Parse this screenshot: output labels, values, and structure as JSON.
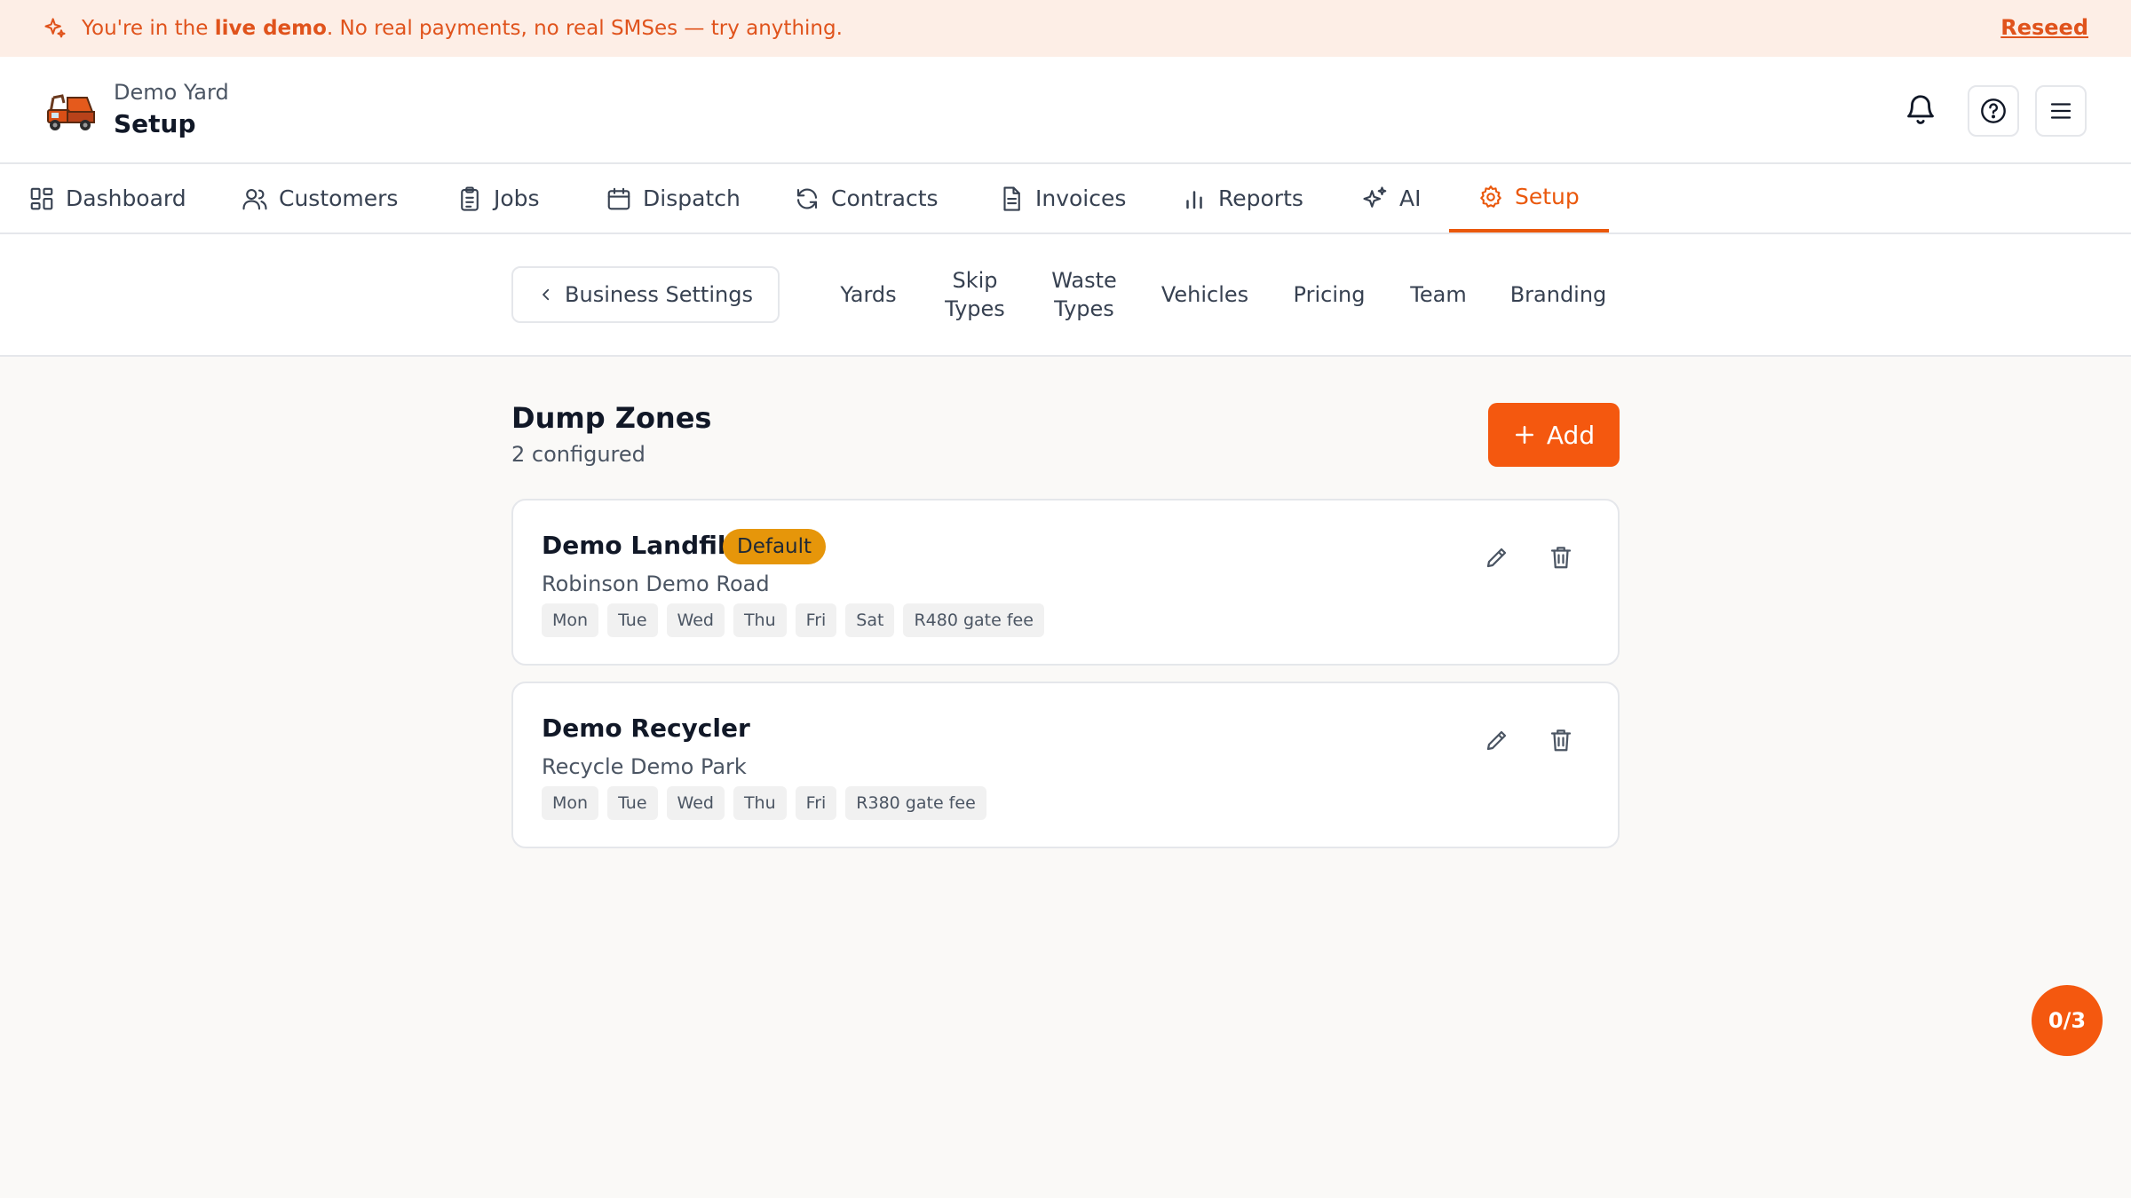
{
  "banner": {
    "text_before": "You're in the ",
    "text_bold": "live demo",
    "text_after": ". No real payments, no real SMSes — try anything.",
    "reseed_label": "Reseed"
  },
  "header": {
    "yard_name": "Demo Yard",
    "page_title": "Setup"
  },
  "nav": {
    "tabs": [
      {
        "label": "Dashboard",
        "icon": "dashboard-icon"
      },
      {
        "label": "Customers",
        "icon": "users-icon"
      },
      {
        "label": "Jobs",
        "icon": "clipboard-icon"
      },
      {
        "label": "Dispatch",
        "icon": "calendar-icon"
      },
      {
        "label": "Contracts",
        "icon": "refresh-icon"
      },
      {
        "label": "Invoices",
        "icon": "document-icon"
      },
      {
        "label": "Reports",
        "icon": "bar-chart-icon"
      },
      {
        "label": "AI",
        "icon": "sparkles-icon"
      },
      {
        "label": "Setup",
        "icon": "gear-icon",
        "active": true
      }
    ]
  },
  "subnav": {
    "back_label": "Business Settings",
    "tabs": [
      {
        "line1": "Yards",
        "line2": ""
      },
      {
        "line1": "Skip",
        "line2": "Types"
      },
      {
        "line1": "Waste",
        "line2": "Types"
      },
      {
        "line1": "Vehicles",
        "line2": ""
      },
      {
        "line1": "Pricing",
        "line2": ""
      },
      {
        "line1": "Team",
        "line2": ""
      },
      {
        "line1": "Branding",
        "line2": ""
      }
    ]
  },
  "section": {
    "title": "Dump Zones",
    "subtitle": "2 configured",
    "add_label": "Add"
  },
  "zones": [
    {
      "name": "Demo Landfill",
      "badge": "Default",
      "address": "Robinson Demo Road",
      "days": [
        "Mon",
        "Tue",
        "Wed",
        "Thu",
        "Fri",
        "Sat"
      ],
      "fee": "R480 gate fee"
    },
    {
      "name": "Demo Recycler",
      "badge": "",
      "address": "Recycle Demo Park",
      "days": [
        "Mon",
        "Tue",
        "Wed",
        "Thu",
        "Fri"
      ],
      "fee": "R380 gate fee"
    }
  ],
  "progress_fab": "0/3",
  "colors": {
    "accent": "#f4580f",
    "banner_bg": "#fdeee6",
    "badge": "#e6960a"
  }
}
